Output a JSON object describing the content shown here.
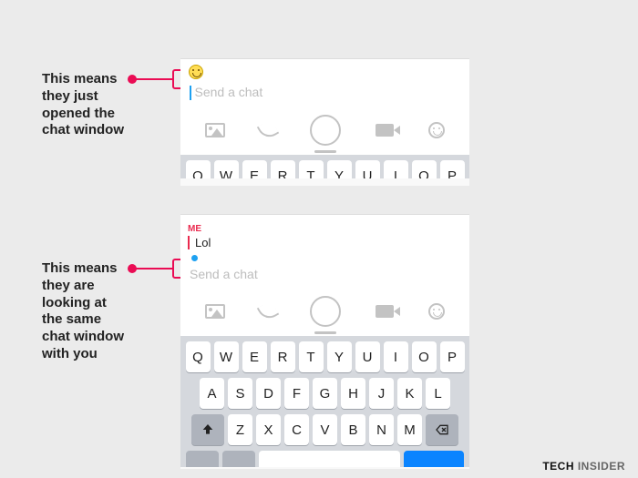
{
  "annotations": {
    "top": "This means\nthey just\nopened the\nchat window",
    "bottom": "This means\nthey are\nlooking at\nthe same\nchat window\nwith you"
  },
  "chat": {
    "placeholder": "Send a chat",
    "me_label": "ME",
    "me_message": "Lol"
  },
  "keyboard": {
    "row1": [
      "Q",
      "W",
      "E",
      "R",
      "T",
      "Y",
      "U",
      "I",
      "O",
      "P"
    ],
    "row2": [
      "A",
      "S",
      "D",
      "F",
      "G",
      "H",
      "J",
      "K",
      "L"
    ],
    "row3": [
      "Z",
      "X",
      "C",
      "V",
      "B",
      "N",
      "M"
    ]
  },
  "footer": {
    "brand_bold": "TECH",
    "brand_light": " INSIDER"
  }
}
